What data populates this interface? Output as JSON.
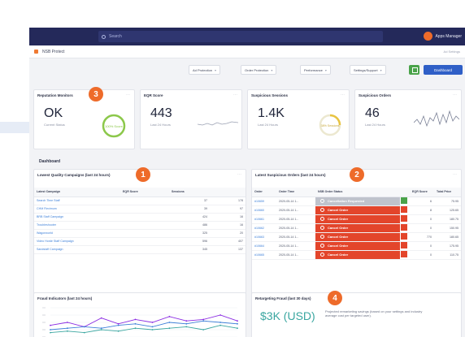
{
  "topbar": {
    "search_placeholder": "Search",
    "user_name": "Apps Manager"
  },
  "breadcrumb": {
    "title": "NSB Protect",
    "edit_link": "Ad Settings"
  },
  "toolbar": {
    "items": [
      "Ad Protection",
      "Order Protection",
      "Performance",
      "Settings/Support"
    ],
    "dashboard_label": "Dashboard"
  },
  "colors": {
    "accent_orange": "#ee6b2a",
    "primary_blue": "#2f5fc7",
    "cancel_red": "#e3452b",
    "good_green": "#4aa34a",
    "fraud_teal": "#3aa6a0"
  },
  "metrics": [
    {
      "title": "Reputation Monitors",
      "value": "OK",
      "sub": "Current Status",
      "gauge": "100% Score",
      "badge": "3"
    },
    {
      "title": "EQR Score",
      "value": "443",
      "sub": "Last 24 Hours"
    },
    {
      "title": "Suspicious Sessions",
      "value": "1.4K",
      "sub": "Last 24 Hours",
      "gauge": "38% Sessions"
    },
    {
      "title": "Suspicious Orders",
      "value": "46",
      "sub": "Last 24 Hours"
    }
  ],
  "dashboard_label": "Dashboard",
  "campaigns": {
    "title": "Lowest Quality Campaigns (last 24 hours)",
    "badge": "1",
    "columns": [
      "Latest Campaign",
      "EQR Score",
      "Sessions",
      ""
    ],
    "rows": [
      [
        "Search Time Staff",
        "",
        "37",
        "178"
      ],
      [
        "CHM Fleximum",
        "",
        "39",
        "97"
      ],
      [
        "BRB Staff Campaign",
        "",
        "424",
        "16"
      ],
      [
        "Troubleshooter",
        "",
        "486",
        "16"
      ],
      [
        "Wagonworld",
        "",
        "325",
        "20"
      ],
      [
        "Video Horde Staff Campaign",
        "",
        "596",
        "407"
      ],
      [
        "Sandstaff Campaign",
        "",
        "345",
        "137"
      ]
    ]
  },
  "orders": {
    "title": "Latest Suspicious Orders (last 24 hours)",
    "badge": "2",
    "columns": [
      "Order",
      "Order Time",
      "NSB Order Status",
      "",
      "EQR Score",
      "Total Price"
    ],
    "first_action": "Cancellation Requested",
    "cancel_label": "Cancel Order",
    "rows": [
      [
        "#10659",
        "2020-05-14 1...",
        "",
        "6",
        "75.95"
      ],
      [
        "#10660",
        "2020-05-14 1...",
        "",
        "8",
        "125.65"
      ],
      [
        "#10661",
        "2020-05-14 1...",
        "",
        "0",
        "180.75"
      ],
      [
        "#10662",
        "2020-05-14 1...",
        "",
        "0",
        "150.95"
      ],
      [
        "#10663",
        "2020-05-14 1...",
        "",
        "770",
        "180.65"
      ],
      [
        "#10664",
        "2020-05-14 1...",
        "",
        "0",
        "175.95"
      ],
      [
        "#10665",
        "2020-05-14 1...",
        "",
        "0",
        "110.75"
      ]
    ]
  },
  "fraud_indicators": {
    "title": "Fraud Indicators (last 24 hours)"
  },
  "retargeting": {
    "title": "Retargeting Fraud (last 30 days)",
    "badge": "4",
    "value": "$3K (USD)",
    "description": "Projected remarketing savings (based on your settings and industry average cost per targeted user)."
  },
  "chart_data": {
    "type": "line",
    "title": "Fraud Indicators (last 24 hours)",
    "series": [
      {
        "name": "",
        "values": [
          8,
          10,
          7,
          13,
          9,
          12,
          10,
          14,
          11,
          12,
          15,
          11
        ]
      },
      {
        "name": "",
        "values": [
          5,
          6,
          7,
          6,
          8,
          9,
          7,
          10,
          9,
          11,
          10,
          9
        ]
      },
      {
        "name": "",
        "values": [
          3,
          4,
          3,
          5,
          4,
          6,
          5,
          6,
          7,
          5,
          8,
          6
        ]
      }
    ],
    "colors": [
      "#8a2be2",
      "#3c7fd8",
      "#3aa6a0"
    ],
    "ylim": [
      0,
      20
    ]
  }
}
